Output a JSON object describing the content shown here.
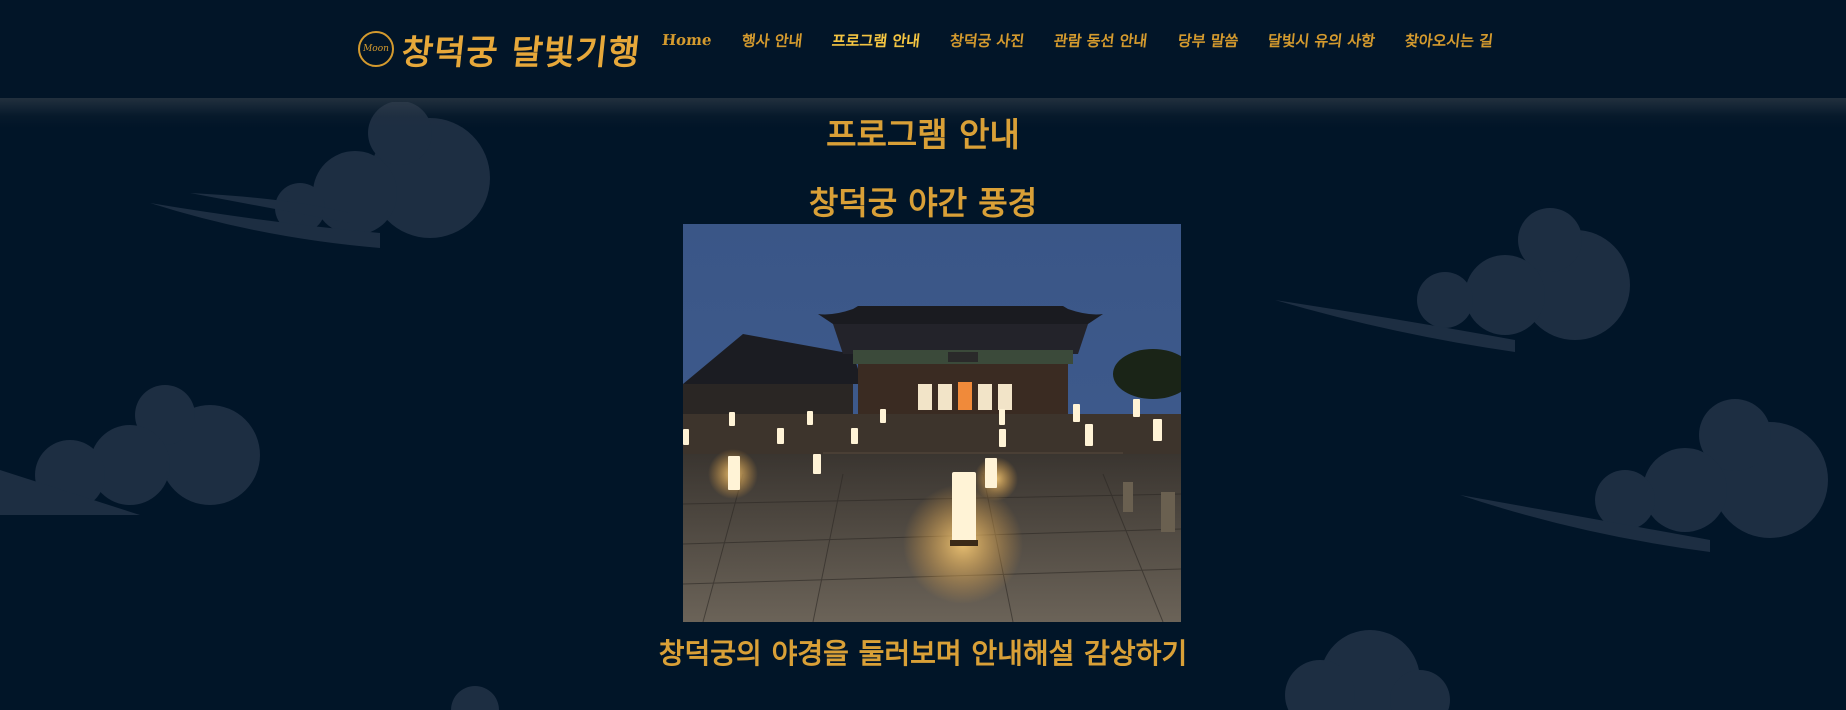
{
  "header": {
    "logo_emblem_text": "Moon",
    "logo_text": "창덕궁 달빛기행",
    "nav": [
      {
        "label": "Home"
      },
      {
        "label": "행사 안내"
      },
      {
        "label": "프로그램 안내"
      },
      {
        "label": "창덕궁 사진"
      },
      {
        "label": "관람 동선 안내"
      },
      {
        "label": "당부 말씀"
      },
      {
        "label": "달빛시 유의 사항"
      },
      {
        "label": "찾아오시는 길"
      }
    ],
    "active_index": 2
  },
  "main": {
    "page_title": "프로그램 안내",
    "section_title": "창덕궁 야간 풍경",
    "caption": "창덕궁의 야경을 둘러보며 안내해설 감상하기"
  },
  "colors": {
    "background": "#011528",
    "accent": "#d9a037",
    "active_nav": "#f4c542",
    "cloud": "#1f3044"
  }
}
